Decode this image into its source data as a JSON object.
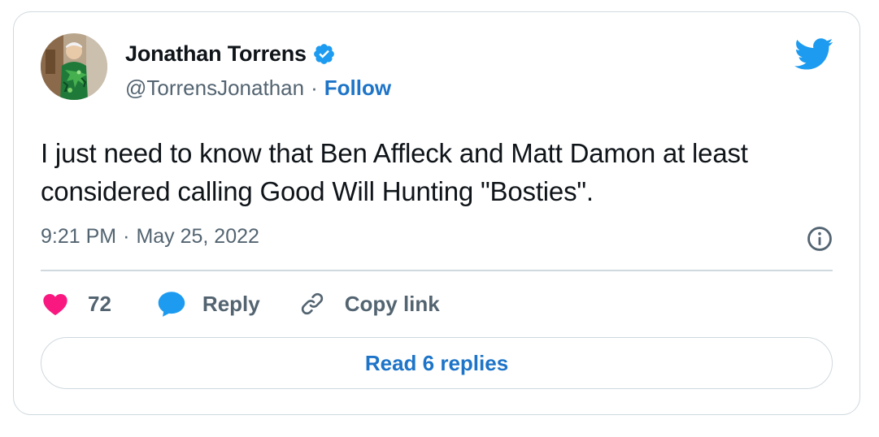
{
  "author": {
    "name": "Jonathan Torrens",
    "handle": "@TorrensJonathan",
    "separator": "·",
    "follow_label": "Follow",
    "verified": true
  },
  "tweet": {
    "text": "I just need to know that Ben Affleck and Matt Damon at least considered calling Good Will Hunting \"Bosties\".",
    "time": "9:21 PM",
    "separator": "·",
    "date": "May 25, 2022"
  },
  "actions": {
    "likes_count": "72",
    "reply_label": "Reply",
    "copy_link_label": "Copy link"
  },
  "read_replies_label": "Read 6 replies",
  "icons": {
    "brand": "twitter-bird-icon",
    "verified": "verified-badge-icon",
    "info": "info-icon",
    "like": "heart-icon",
    "reply": "speech-bubble-icon",
    "copy": "link-icon"
  },
  "colors": {
    "accent": "#1d74c8",
    "twitter_blue": "#1d9bf0",
    "like": "#f91880",
    "muted_text": "#536471",
    "border": "#cfd9de"
  }
}
